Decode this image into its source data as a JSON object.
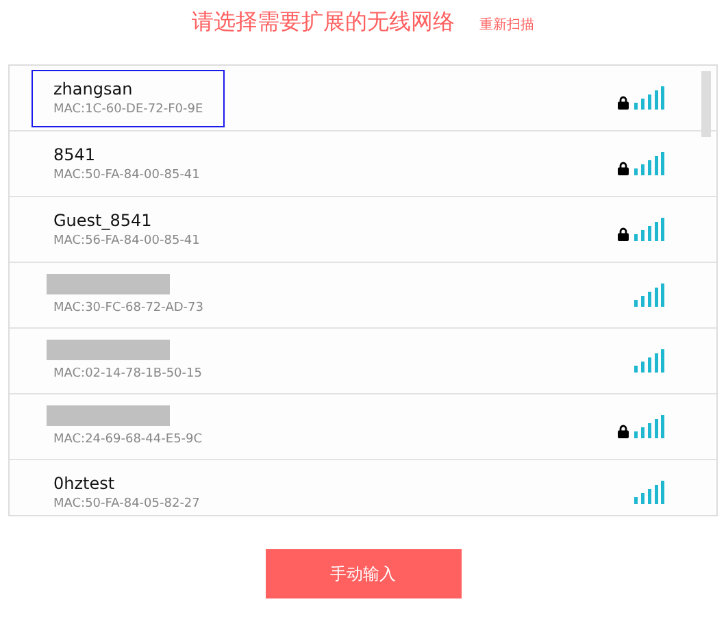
{
  "header": {
    "title": "请选择需要扩展的无线网络",
    "rescan_link": "重新扫描"
  },
  "networks": [
    {
      "kind": "named",
      "name": "zhangsan",
      "mac": "MAC:1C-60-DE-72-F0-9E",
      "locked": true,
      "selected": true
    },
    {
      "kind": "named",
      "name": "8541",
      "mac": "MAC:50-FA-84-00-85-41",
      "locked": true,
      "selected": false
    },
    {
      "kind": "named",
      "name": "Guest_8541",
      "mac": "MAC:56-FA-84-00-85-41",
      "locked": true,
      "selected": false
    },
    {
      "kind": "redacted",
      "mac": "MAC:30-FC-68-72-AD-73",
      "locked": false,
      "selected": false
    },
    {
      "kind": "redacted",
      "mac": "MAC:02-14-78-1B-50-15",
      "locked": false,
      "selected": false
    },
    {
      "kind": "redacted",
      "mac": "MAC:24-69-68-44-E5-9C",
      "locked": true,
      "selected": false
    },
    {
      "kind": "named",
      "name": "0hztest",
      "mac": "MAC:50-FA-84-05-82-27",
      "locked": false,
      "selected": false
    }
  ],
  "manual_button": "手动输入"
}
